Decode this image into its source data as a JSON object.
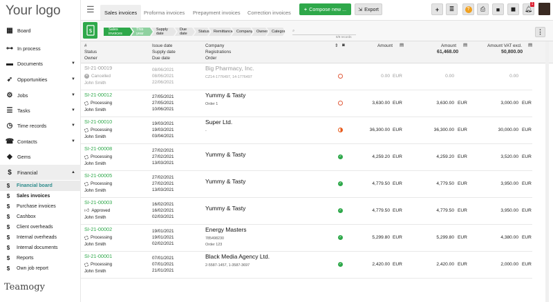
{
  "sidebar": {
    "logo": "Your logo",
    "items": [
      {
        "label": "Board",
        "icon": "grid-icon",
        "caret": ""
      },
      {
        "label": "In process",
        "icon": "flow-icon",
        "caret": ""
      },
      {
        "label": "Documents",
        "icon": "folder-icon",
        "caret": "▼"
      },
      {
        "label": "Opportunities",
        "icon": "rocket-icon",
        "caret": "▼"
      },
      {
        "label": "Jobs",
        "icon": "gears-icon",
        "caret": "▼"
      },
      {
        "label": "Tasks",
        "icon": "tasks-icon",
        "caret": "▼"
      },
      {
        "label": "Time records",
        "icon": "clock-icon",
        "caret": "▼"
      },
      {
        "label": "Contacts",
        "icon": "contacts-icon",
        "caret": "▼"
      },
      {
        "label": "Gems",
        "icon": "gem-icon",
        "caret": ""
      },
      {
        "label": "Financial",
        "icon": "dollar-icon",
        "caret": "▲"
      }
    ],
    "financial_sub": [
      "Financial board",
      "Sales invoices",
      "Purchase invoices",
      "Cashbox",
      "Client overheads",
      "Internal overheads",
      "Internal documents",
      "Reports",
      "Own job report"
    ],
    "brand": "TEAMOGY"
  },
  "tabs": [
    "Sales invoices",
    "Proforma invoices",
    "Prepayment invoices",
    "Correction invoices"
  ],
  "toolbar": {
    "compose": "Compose new ...",
    "export": "Export",
    "notif_count": "1"
  },
  "filters": {
    "crumbs": [
      "Sales invoices",
      "This year",
      "Supply date",
      "Due date",
      "Status",
      "Remittance",
      "Company",
      "Owner",
      "Category"
    ],
    "search_placeholder": "",
    "count": "8/8 records"
  },
  "columns": {
    "col1": [
      "#",
      "Status",
      "Owner"
    ],
    "col2": [
      "Issue date",
      "Supply date",
      "Due date"
    ],
    "col3": [
      "Company",
      "Registrations",
      "Order"
    ],
    "amount": "Amount",
    "amount2": "Amount",
    "amount2_total": "61,468.00",
    "vat": "Amount VAT excl.",
    "vat_total": "50,800.00"
  },
  "rows": [
    {
      "num": "SI-21-00019",
      "status": "Cancelled",
      "owner": "John Smith",
      "d1": "08/06/2021",
      "d2": "08/06/2021",
      "d3": "22/06/2021",
      "company": "Big Pharmacy, Inc.",
      "reg": "CZ14-1776497, 14-1776497",
      "order": "",
      "indicator": "ring",
      "a1": "0.00",
      "c1": "EUR",
      "a2": "0.00",
      "c2": "",
      "a3": "0.00",
      "c3": "",
      "muted": true,
      "stat_icon": "x"
    },
    {
      "num": "SI-21-00012",
      "status": "Processing",
      "owner": "John Smith",
      "d1": "27/05/2021",
      "d2": "27/05/2021",
      "d3": "10/06/2021",
      "company": "Yummy & Tasty",
      "reg": "Order 1",
      "order": "",
      "indicator": "ring",
      "a1": "3,630.00",
      "c1": "EUR",
      "a2": "3,630.00",
      "c2": "EUR",
      "a3": "3,000.00",
      "c3": "EUR",
      "muted": false,
      "stat_icon": "spin"
    },
    {
      "num": "SI-21-00010",
      "status": "Processing",
      "owner": "John Smith",
      "d1": "19/03/2021",
      "d2": "19/03/2021",
      "d3": "03/04/2021",
      "company": "Super Ltd.",
      "reg": "-",
      "order": "",
      "indicator": "half",
      "a1": "36,300.00",
      "c1": "EUR",
      "a2": "36,300.00",
      "c2": "EUR",
      "a3": "30,000.00",
      "c3": "EUR",
      "muted": false,
      "stat_icon": "spin"
    },
    {
      "num": "SI-21-00008",
      "status": "Processing",
      "owner": "John Smith",
      "d1": "27/02/2021",
      "d2": "27/02/2021",
      "d3": "13/03/2021",
      "company": "Yummy & Tasty",
      "reg": "",
      "order": "",
      "indicator": "ok",
      "a1": "4,259.20",
      "c1": "EUR",
      "a2": "4,259.20",
      "c2": "EUR",
      "a3": "3,520.00",
      "c3": "EUR",
      "muted": false,
      "stat_icon": "spin"
    },
    {
      "num": "SI-21-00005",
      "status": "Processing",
      "owner": "John Smith",
      "d1": "27/02/2021",
      "d2": "27/02/2021",
      "d3": "13/03/2021",
      "company": "Yummy & Tasty",
      "reg": "",
      "order": "",
      "indicator": "ok",
      "a1": "4,779.50",
      "c1": "EUR",
      "a2": "4,779.50",
      "c2": "EUR",
      "a3": "3,950.00",
      "c3": "EUR",
      "muted": false,
      "stat_icon": "spin"
    },
    {
      "num": "SI-21-00003",
      "status": "Approved",
      "owner": "John Smith",
      "d1": "16/02/2021",
      "d2": "16/02/2021",
      "d3": "02/03/2021",
      "company": "Yummy & Tasty",
      "reg": "",
      "order": "",
      "indicator": "ok",
      "a1": "4,779.50",
      "c1": "EUR",
      "a2": "4,779.50",
      "c2": "EUR",
      "a3": "3,950.00",
      "c3": "EUR",
      "muted": false,
      "stat_icon": "thumb"
    },
    {
      "num": "SI-21-00002",
      "status": "Processing",
      "owner": "John Smith",
      "d1": "19/01/2021",
      "d2": "19/01/2021",
      "d3": "02/02/2021",
      "company": "Energy Masters",
      "reg": "785498230",
      "order": "Order 123",
      "indicator": "ok",
      "a1": "5,299.80",
      "c1": "EUR",
      "a2": "5,299.80",
      "c2": "EUR",
      "a3": "4,380.00",
      "c3": "EUR",
      "muted": false,
      "stat_icon": "spin"
    },
    {
      "num": "SI-21-00001",
      "status": "Processing",
      "owner": "John Smith",
      "d1": "07/01/2021",
      "d2": "07/01/2021",
      "d3": "21/01/2021",
      "company": "Black Media Agency Ltd.",
      "reg": "2-5587-1457, 1-3587-3697",
      "order": "",
      "indicator": "ok",
      "a1": "2,420.00",
      "c1": "EUR",
      "a2": "2,420.00",
      "c2": "EUR",
      "a3": "2,000.00",
      "c3": "EUR",
      "muted": false,
      "stat_icon": "spin"
    }
  ],
  "colors": {
    "accent": "#2ea84a",
    "link_teal": "#2d8c8c",
    "warning": "#e05a3a"
  }
}
